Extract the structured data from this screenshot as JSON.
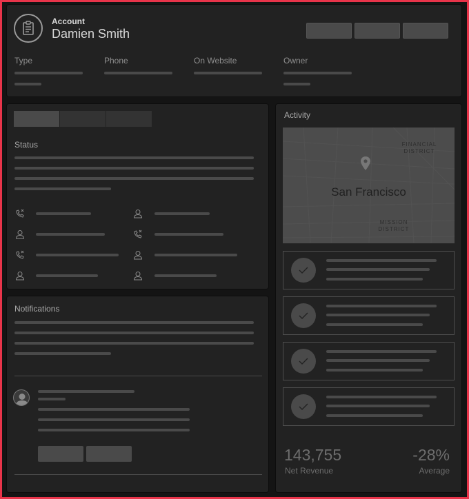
{
  "header": {
    "icon": "clipboard-icon",
    "title": "Account",
    "name": "Damien Smith",
    "fields": [
      {
        "label": "Type"
      },
      {
        "label": "Phone"
      },
      {
        "label": "On Website"
      },
      {
        "label": "Owner"
      }
    ]
  },
  "status": {
    "title": "Status",
    "icons_left": [
      "phone-missed-icon",
      "user-icon",
      "phone-missed-icon",
      "user-icon"
    ],
    "icons_right": [
      "user-icon",
      "phone-missed-icon",
      "user-icon",
      "user-icon"
    ]
  },
  "notifications": {
    "title": "Notifications",
    "avatar_icon": "user-avatar-icon"
  },
  "activity": {
    "title": "Activity",
    "map": {
      "city": "San Francisco",
      "district_top": "FINANCIAL DISTRICT",
      "district_bottom": "MISSION DISTRICT"
    },
    "items_icon": "check-icon",
    "metrics": {
      "revenue_value": "143,755",
      "revenue_label": "Net Revenue",
      "average_value": "-28%",
      "average_label": "Average"
    }
  },
  "colors": {
    "frame": "#e8344a",
    "card": "#222222",
    "placeholder": "#4a4a4a"
  }
}
